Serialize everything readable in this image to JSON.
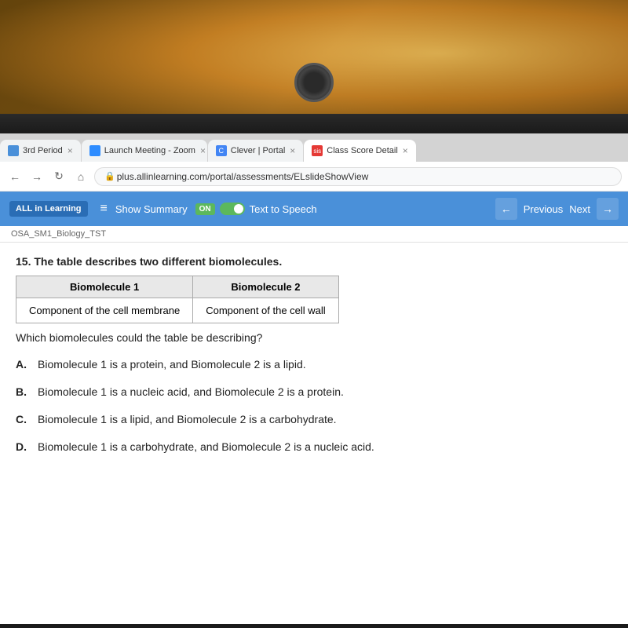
{
  "top_area": {
    "webcam_label": "webcam"
  },
  "tabs": [
    {
      "id": "tab1",
      "label": "3rd Period",
      "icon_color": "#4a90d9",
      "active": false
    },
    {
      "id": "tab2",
      "label": "Launch Meeting - Zoom",
      "icon_color": "#2D8CFF",
      "active": false
    },
    {
      "id": "tab3",
      "label": "Clever | Portal",
      "icon_color": "#4285F4",
      "active": false
    },
    {
      "id": "tab4",
      "label": "Class Score Detail",
      "icon_color": "#e53935",
      "active": true
    }
  ],
  "address_bar": {
    "url": "plus.allinlearning.com/portal/assessments/ELslideShowView"
  },
  "toolbar": {
    "brand": "ALL in Learning",
    "menu_icon": "≡",
    "show_summary": "Show Summary",
    "toggle_on_label": "ON",
    "text_to_speech": "Text to Speech",
    "previous_label": "Previous",
    "next_label": "Next"
  },
  "breadcrumb": {
    "path": "OSA_SM1_Biology_TST"
  },
  "question": {
    "number": "15.",
    "stem": "The table describes two different biomolecules.",
    "table": {
      "headers": [
        "Biomolecule 1",
        "Biomolecule 2"
      ],
      "rows": [
        [
          "Component of the cell membrane",
          "Component of the cell wall"
        ]
      ]
    },
    "which_question": "Which  biomolecules could the table be describing?",
    "options": [
      {
        "letter": "A.",
        "text": "Biomolecule 1 is a protein, and Biomolecule 2 is a lipid."
      },
      {
        "letter": "B.",
        "text": "Biomolecule 1 is a nucleic acid, and Biomolecule 2 is a protein."
      },
      {
        "letter": "C.",
        "text": "Biomolecule 1 is a lipid, and Biomolecule 2 is a carbohydrate."
      },
      {
        "letter": "D.",
        "text": "Biomolecule 1 is a carbohydrate, and Biomolecule 2 is a nucleic acid."
      }
    ]
  }
}
